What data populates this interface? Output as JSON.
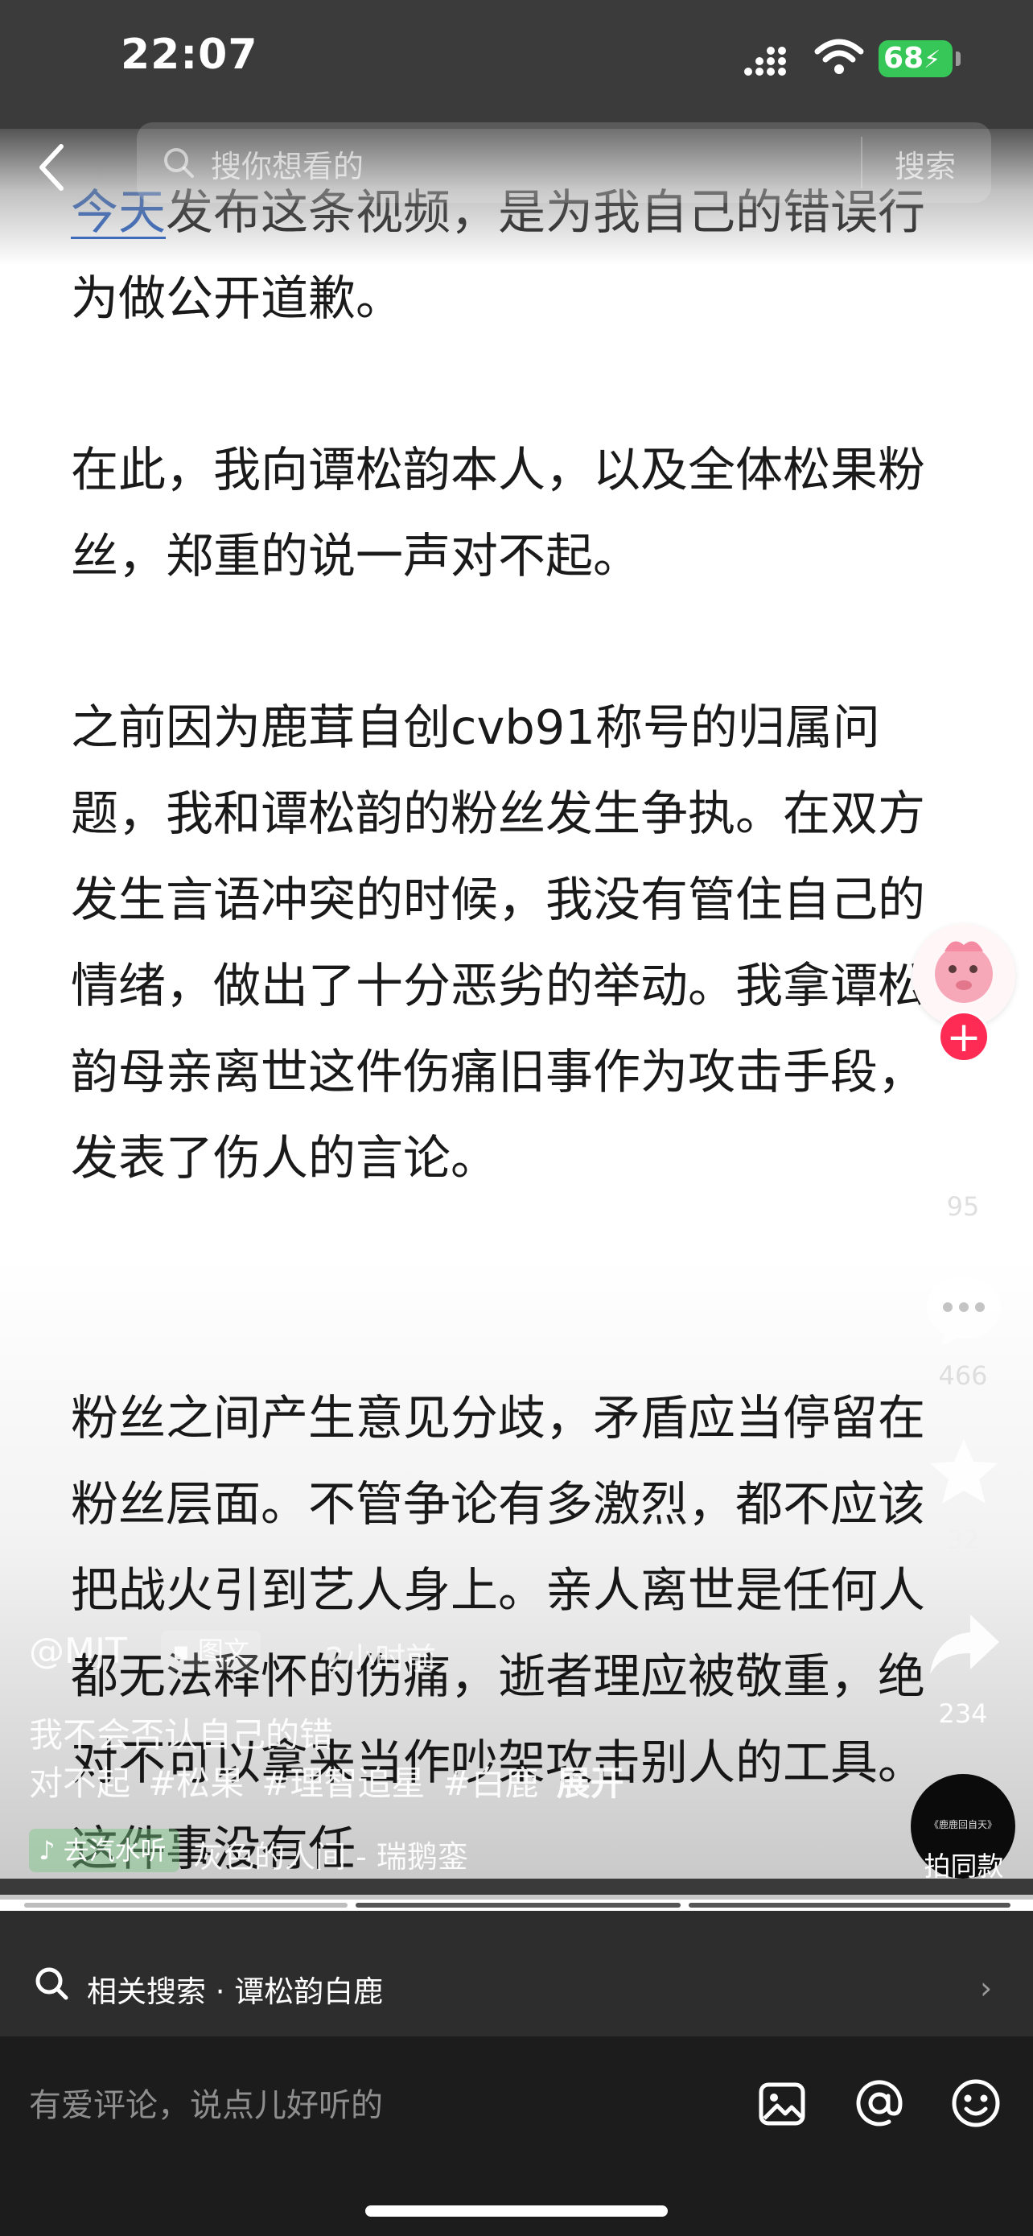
{
  "status_bar": {
    "time": "22:07",
    "battery": "68"
  },
  "search": {
    "placeholder": "搜你想看的",
    "button": "搜索"
  },
  "article": {
    "para1_highlight": "今天",
    "para1_rest": "发布这条视频，是为我自己的错误行为做公开道歉。",
    "para2": "在此，我向谭松韵本人，以及全体松果粉丝，郑重的说一声对不起。",
    "para3": "之前因为鹿茸自创cvb91称号的归属问题，我和谭松韵的粉丝发生争执。在双方发生言语冲突的时候，我没有管住自己的情绪，做出了十分恶劣的举动。我拿谭松韵母亲离世这件伤痛旧事作为攻击手段，发表了伤人的言论。",
    "para4": "粉丝之间产生意见分歧，矛盾应当停留在粉丝层面。不管争论有多激烈，都不应该把战火引到艺人身上。亲人离世是任何人都无法释怀的伤痛，逝者理应被敬重，绝对不可以拿来当作吵架攻击别人的工具。这件事没有任"
  },
  "actions": {
    "follow": "+",
    "likes": "95",
    "comments": "466",
    "favorites": "32",
    "shares": "234",
    "remix_label": "拍同款",
    "remix_disc_text": "《鹿鹿回自天》"
  },
  "post": {
    "author": "@MJT",
    "type_badge": "图文",
    "time": "2小时前",
    "caption": "我不会否认自己的错",
    "caption_prefix": "对不起",
    "tags": [
      "#松果",
      "#理智追星",
      "#白鹿"
    ],
    "expand": "展开",
    "music_badge": "去汽水听",
    "music_title": "灰色的人间 - 瑞鹅銮"
  },
  "related_search": {
    "label": "相关搜索 · 谭松韵白鹿"
  },
  "comment_bar": {
    "placeholder": "有爱评论，说点儿好听的"
  },
  "colors": {
    "follow": "#fe2c55",
    "link": "#2b63c5",
    "battery": "#37c759",
    "bar_dark": "#2d2d2d",
    "bar_darker": "#1c1c1c"
  }
}
